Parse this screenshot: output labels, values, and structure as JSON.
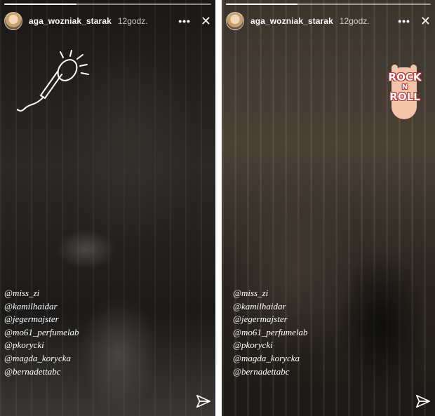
{
  "stories": [
    {
      "username": "aga_wozniak_starak",
      "time": "12godz.",
      "more_icon": "more-dots-icon",
      "close_icon": "close-icon",
      "send_icon": "send-icon",
      "sticker": "microphone-sticker",
      "progress": 0.35,
      "mentions": [
        "@miss_zi",
        "@kamilhaidar",
        "@jegermajster",
        "@mo61_perfumelab",
        "@pkorycki",
        "@magda_korycka",
        "@bernadettabc"
      ]
    },
    {
      "username": "aga_wozniak_starak",
      "time": "12godz.",
      "more_icon": "more-dots-icon",
      "close_icon": "close-icon",
      "send_icon": "send-icon",
      "sticker": "rock-n-roll-sticker",
      "sticker_text": [
        "ROCK",
        "N",
        "ROLL"
      ],
      "progress": 0.35,
      "mentions": [
        "@miss_zi",
        "@kamilhaidar",
        "@jegermajster",
        "@mo61_perfumelab",
        "@pkorycki",
        "@magda_korycka",
        "@bernadettabc"
      ]
    }
  ],
  "colors": {
    "text": "#ffffff",
    "sticker_outline": "#b33333",
    "sticker_hand": "#f1c3a8"
  }
}
